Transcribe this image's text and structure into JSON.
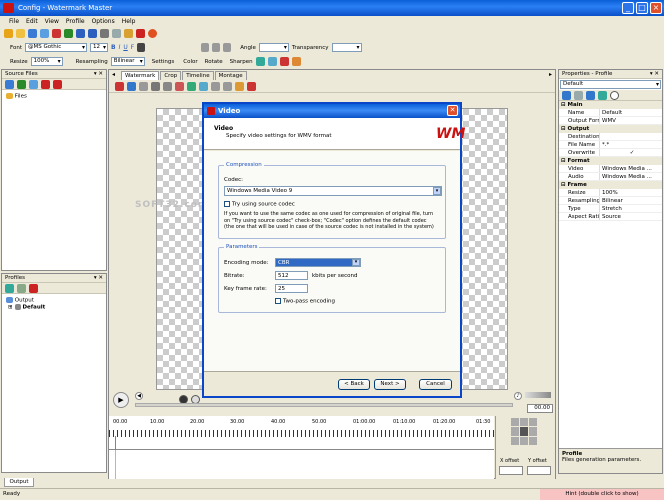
{
  "window": {
    "title": "Config - Watermark Master"
  },
  "menu": [
    "File",
    "Edit",
    "View",
    "Profile",
    "Options",
    "Help"
  ],
  "format_bar": {
    "font_label": "Font",
    "font_value": "@MS Gothic",
    "size_value": "12",
    "bold": "B",
    "italic": "I",
    "underline": "U",
    "font_f": "F",
    "angle_label": "Angle",
    "transparency_label": "Transparency"
  },
  "resize_bar": {
    "resize_label": "Resize",
    "resize_value": "100%",
    "resampling_label": "Resampling",
    "resampling_value": "Bilinear",
    "settings_label": "Settings",
    "color_label": "Color",
    "rotate_label": "Rotate",
    "sharpen_label": "Sharpen"
  },
  "source_files": {
    "title": "Source Files",
    "controls": "▾ ✕",
    "tree_item": "Files"
  },
  "profiles": {
    "title": "Profiles",
    "controls": "▾ ✕",
    "output": "Output",
    "default": "Default"
  },
  "tabs": [
    "Watermark",
    "Crop",
    "Timeline",
    "Montage"
  ],
  "dialog": {
    "title": "Video",
    "heading": "Video",
    "subheading": "Specify video settings for WMV format",
    "compression": {
      "label": "Compression",
      "codec_label": "Codec:",
      "codec_value": "Windows Media Video 9",
      "try_source": "Try using source codec",
      "note1": "If you want to use the same codec as one used for compression of original file, turn",
      "note2": "on \"Try using source codec\" check-box; \"Codec\" option defines the default codec",
      "note3": "(the one that will be used in case of the source codec is not installed in the system)"
    },
    "parameters": {
      "label": "Parameters",
      "encoding_label": "Encoding mode:",
      "encoding_value": "CBR",
      "bitrate_label": "Bitrate:",
      "bitrate_value": "512",
      "bitrate_unit": "kbits per second",
      "keyframe_label": "Key frame rate:",
      "keyframe_value": "25",
      "twopass_label": "Two-pass encoding"
    },
    "buttons": {
      "back": "< Back",
      "next": "Next >",
      "cancel": "Cancel"
    }
  },
  "player": {
    "time": "00.00"
  },
  "timeline": {
    "ticks": [
      "00.00",
      "10.00",
      "20.00",
      "30.00",
      "40.00",
      "50.00",
      "01:00.00",
      "01:10.00",
      "01:20.00",
      "01:30"
    ],
    "x_offset_label": "X offset",
    "y_offset_label": "Y offset"
  },
  "properties": {
    "title": "Properties - Profile",
    "controls": "▾ ✕",
    "selector": "Default",
    "categories": [
      {
        "name": "Main",
        "rows": [
          {
            "key": "Name",
            "value": "Default"
          },
          {
            "key": "Output Format",
            "value": "WMV"
          }
        ]
      },
      {
        "name": "Output",
        "rows": [
          {
            "key": "Destination",
            "value": ""
          },
          {
            "key": "File Name",
            "value": "*.*"
          },
          {
            "key": "Overwrite",
            "value": "✓"
          }
        ]
      },
      {
        "name": "Format",
        "rows": [
          {
            "key": "Video",
            "value": "Windows Media ..."
          },
          {
            "key": "Audio",
            "value": "Windows Media ..."
          }
        ]
      },
      {
        "name": "Frame",
        "rows": [
          {
            "key": "Resize",
            "value": "100%"
          },
          {
            "key": "Resampling",
            "value": "Bilinear"
          },
          {
            "key": "Type",
            "value": "Stretch"
          },
          {
            "key": "Aspect Ratio",
            "value": "Source"
          }
        ]
      }
    ],
    "help_title": "Profile",
    "help_text": "Files generation parameters."
  },
  "output_tab": "Output",
  "status": {
    "left": "Ready",
    "hint": "Hint (double click to show)"
  },
  "colors": {
    "title_blue": "#0a5fd8",
    "accent_red": "#cc1111",
    "hint_bg": "#f7c3c3"
  }
}
